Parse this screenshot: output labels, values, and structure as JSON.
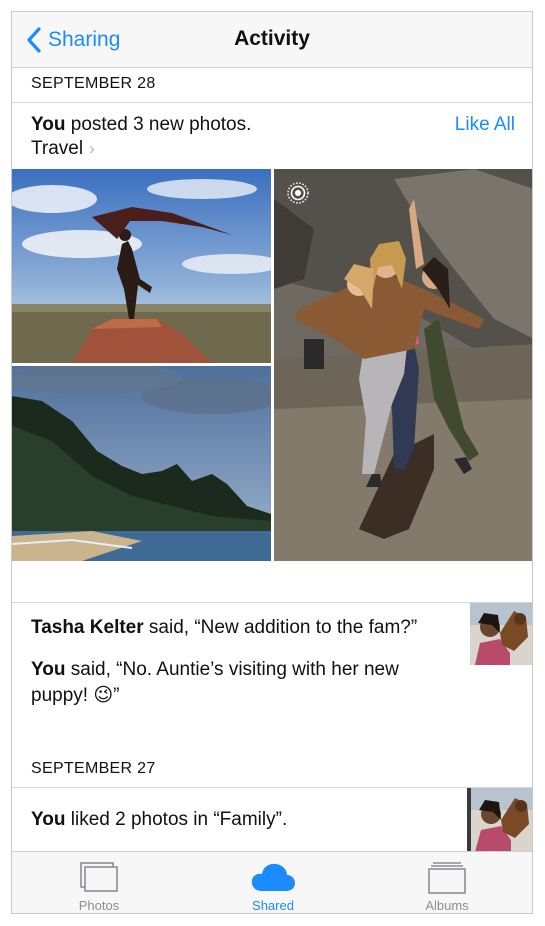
{
  "nav": {
    "back_label": "Sharing",
    "title": "Activity"
  },
  "sections": [
    {
      "date": "SEPTEMBER 28",
      "post": {
        "actor": "You",
        "text": " posted 3 new photos.",
        "like_all_label": "Like All",
        "album": "Travel"
      },
      "comments": [
        {
          "author": "Tasha Kelter",
          "text": " said, “New addition to the fam?”"
        },
        {
          "author": "You",
          "text": " said, “No. Auntie’s visiting with her new puppy! 😉”"
        }
      ]
    },
    {
      "date": "SEPTEMBER 27",
      "post": {
        "actor": "You",
        "text": " liked 2 photos in “Family”."
      }
    }
  ],
  "tabs": [
    {
      "label": "Photos",
      "icon": "photos-stack-icon",
      "selected": false
    },
    {
      "label": "Shared",
      "icon": "cloud-icon",
      "selected": true
    },
    {
      "label": "Albums",
      "icon": "albums-icon",
      "selected": false
    }
  ],
  "colors": {
    "accent": "#1a8cff",
    "inactive_tab": "#8e8e93",
    "separator": "#d8d8dc"
  }
}
